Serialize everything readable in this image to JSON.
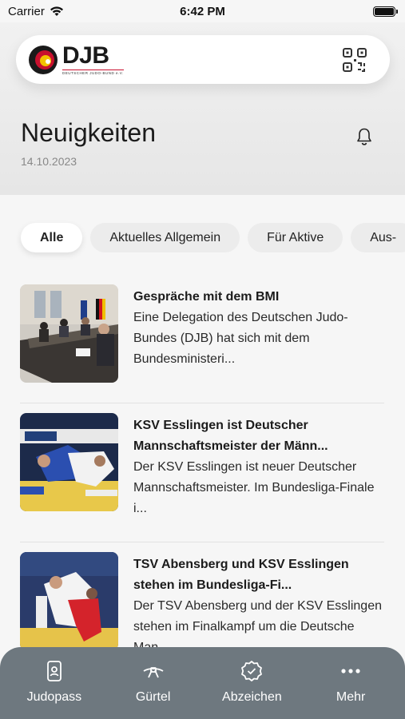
{
  "status_bar": {
    "carrier": "Carrier",
    "time": "6:42 PM"
  },
  "logo": {
    "text": "DJB",
    "subtitle": "DEUTSCHER JUDO-BUND e.V."
  },
  "page": {
    "title": "Neuigkeiten",
    "date": "14.10.2023"
  },
  "filters": [
    "Alle",
    "Aktuelles Allgemein",
    "Für Aktive",
    "Aus-"
  ],
  "news": [
    {
      "title": "Gespräche mit dem BMI",
      "body": "Eine Delegation des Deutschen Judo-Bundes (DJB) hat sich mit dem Bundesministeri..."
    },
    {
      "title": "KSV Esslingen ist Deutscher Mannschaftsmeister der Männ...",
      "body": "Der KSV Esslingen ist neuer Deutscher Mannschaftsmeister. Im Bundesliga-Finale i..."
    },
    {
      "title": "TSV Abensberg und KSV Esslingen stehen im Bundesliga-Fi...",
      "body": "Der TSV Abensberg und der KSV Esslingen stehen im Finalkampf um die Deutsche Man..."
    }
  ],
  "nav": [
    {
      "label": "Judopass",
      "icon": "id-card-icon"
    },
    {
      "label": "Gürtel",
      "icon": "belt-icon"
    },
    {
      "label": "Abzeichen",
      "icon": "badge-icon"
    },
    {
      "label": "Mehr",
      "icon": "more-icon"
    }
  ],
  "colors": {
    "nav_bg": "#6e787f",
    "brand_red": "#c8102e",
    "brand_yellow": "#f2c200"
  }
}
